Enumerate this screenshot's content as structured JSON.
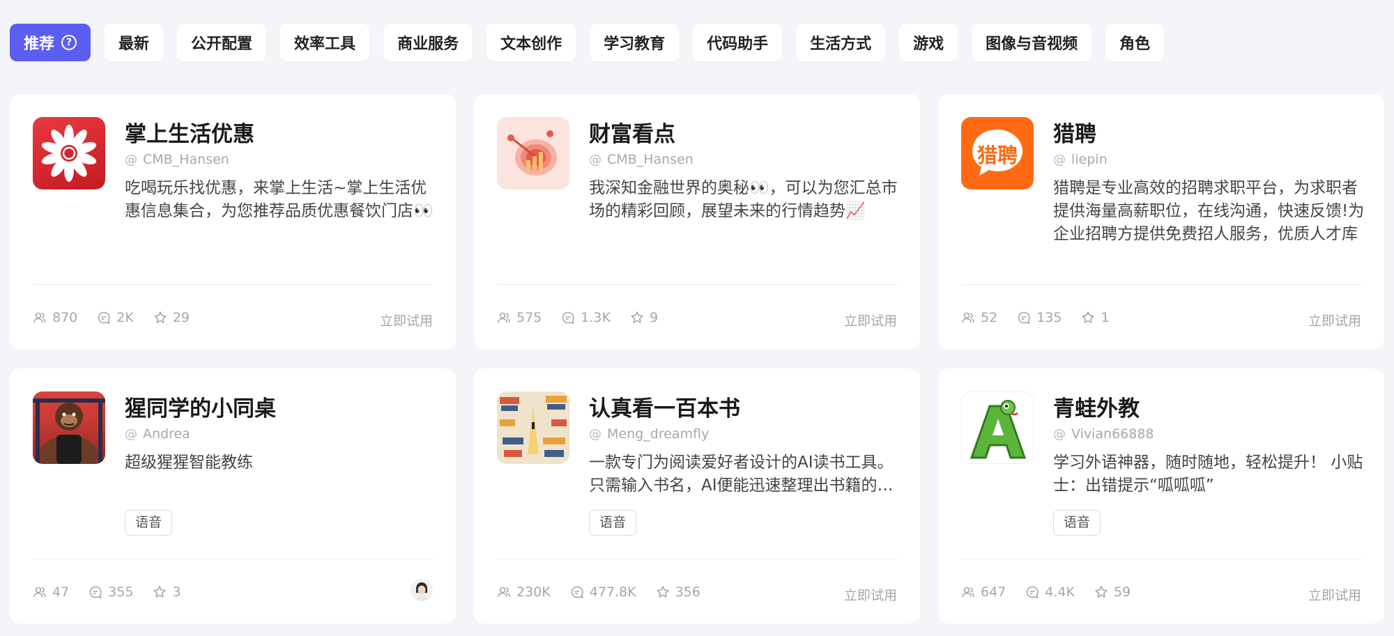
{
  "filters": [
    {
      "label": "推荐",
      "active": true
    },
    {
      "label": "最新"
    },
    {
      "label": "公开配置"
    },
    {
      "label": "效率工具"
    },
    {
      "label": "商业服务"
    },
    {
      "label": "文本创作"
    },
    {
      "label": "学习教育"
    },
    {
      "label": "代码助手"
    },
    {
      "label": "生活方式"
    },
    {
      "label": "游戏"
    },
    {
      "label": "图像与音视频"
    },
    {
      "label": "角色"
    }
  ],
  "help_icon": "?",
  "cards": [
    {
      "title": "掌上生活优惠",
      "author": "CMB_Hansen",
      "description": "吃喝玩乐找优惠，来掌上生活~掌上生活优惠信息集合，为您推荐品质优惠餐饮门店👀",
      "users": "870",
      "comments": "2K",
      "stars": "29",
      "action": "立即试用"
    },
    {
      "title": "财富看点",
      "author": "CMB_Hansen",
      "description": "我深知金融世界的奥秘👀，可以为您汇总市场的精彩回顾，展望未来的行情趋势📈",
      "users": "575",
      "comments": "1.3K",
      "stars": "9",
      "action": "立即试用"
    },
    {
      "title": "猎聘",
      "author": "liepin",
      "avatar_text": "猎聘",
      "description": "猎聘是专业高效的招聘求职平台，为求职者提供海量高薪职位，在线沟通，快速反馈!为企业招聘方提供免费招人服务，优质人才库",
      "users": "52",
      "comments": "135",
      "stars": "1",
      "action": "立即试用"
    },
    {
      "title": "猩同学的小同桌",
      "author": "Andrea",
      "description": "超级猩猩智能教练",
      "tag": "语音",
      "users": "47",
      "comments": "355",
      "stars": "3"
    },
    {
      "title": "认真看一百本书",
      "author": "Meng_dreamfly",
      "description": "一款专门为阅读爱好者设计的AI读书工具。只需输入书名，AI便能迅速整理出书籍的核心内容",
      "tag": "语音",
      "users": "230K",
      "comments": "477.8K",
      "stars": "356",
      "action": "立即试用"
    },
    {
      "title": "青蛙外教",
      "author": "Vivian66888",
      "description": "学习外语神器，随时随地，轻松提升！ 小贴士：出错提示“呱呱呱”",
      "tag": "语音",
      "users": "647",
      "comments": "4.4K",
      "stars": "59",
      "action": "立即试用"
    }
  ],
  "colors": {
    "accent": "#5b5ef0",
    "background": "#f4f5f8",
    "card": "#ffffff",
    "muted_text": "#a6a6a6",
    "liepin_orange": "#ff6a13",
    "cmb_red": "#d8232a"
  },
  "icons": {
    "users": "users-icon",
    "comments": "comment-icon",
    "stars": "star-icon",
    "author": "at-icon",
    "help": "question-circle-icon"
  }
}
